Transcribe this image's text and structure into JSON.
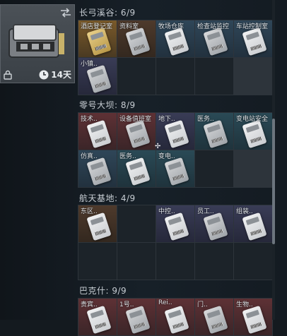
{
  "case_slot": {
    "timer": "14天",
    "icons": {
      "sort": "sort-icon",
      "lock": "lock-icon",
      "clock": "clock-icon"
    }
  },
  "sections": [
    {
      "title": "长弓溪谷: 6/9",
      "cells": [
        {
          "label": "酒店登记室",
          "color": "gold"
        },
        {
          "label": "资料室",
          "color": "brown"
        },
        {
          "label": "牧场仓库",
          "color": "blue"
        },
        {
          "label": "检查站监控",
          "color": "blue"
        },
        {
          "label": "车站控制室",
          "color": "blue"
        },
        {
          "label": "小镇..",
          "color": "purple"
        },
        {
          "label": "",
          "color": "empty"
        },
        {
          "label": "",
          "color": "empty"
        },
        {
          "label": "",
          "color": "empty"
        }
      ]
    },
    {
      "title": "零号大坝: 8/9",
      "cells": [
        {
          "label": "技术..",
          "color": "red"
        },
        {
          "label": "设备值班室",
          "color": "red"
        },
        {
          "label": "地下..",
          "color": "purple"
        },
        {
          "label": "医务..",
          "color": "teal"
        },
        {
          "label": "变电站安全",
          "color": "teal"
        },
        {
          "label": "仿真..",
          "color": "blue"
        },
        {
          "label": "医务..",
          "color": "teal"
        },
        {
          "label": "变电..",
          "color": "teal"
        },
        {
          "label": "",
          "color": "empty"
        }
      ]
    },
    {
      "title": "航天基地: 4/9",
      "cells": [
        {
          "label": "东区..",
          "color": "brown"
        },
        {
          "label": "",
          "color": "empty"
        },
        {
          "label": "中控..",
          "color": "purple"
        },
        {
          "label": "员工..",
          "color": "purple"
        },
        {
          "label": "组装..",
          "color": "purple"
        },
        {
          "label": "",
          "color": "empty"
        },
        {
          "label": "",
          "color": "empty"
        },
        {
          "label": "",
          "color": "empty"
        },
        {
          "label": "",
          "color": "empty"
        },
        {
          "label": "",
          "color": "empty"
        }
      ]
    },
    {
      "title": "巴克什: 9/9",
      "cells": [
        {
          "label": "贵宾..",
          "color": "red"
        },
        {
          "label": "1号..",
          "color": "red"
        },
        {
          "label": "Rei..",
          "color": "red"
        },
        {
          "label": "门..",
          "color": "red"
        },
        {
          "label": "生物..",
          "color": "red"
        }
      ]
    }
  ]
}
